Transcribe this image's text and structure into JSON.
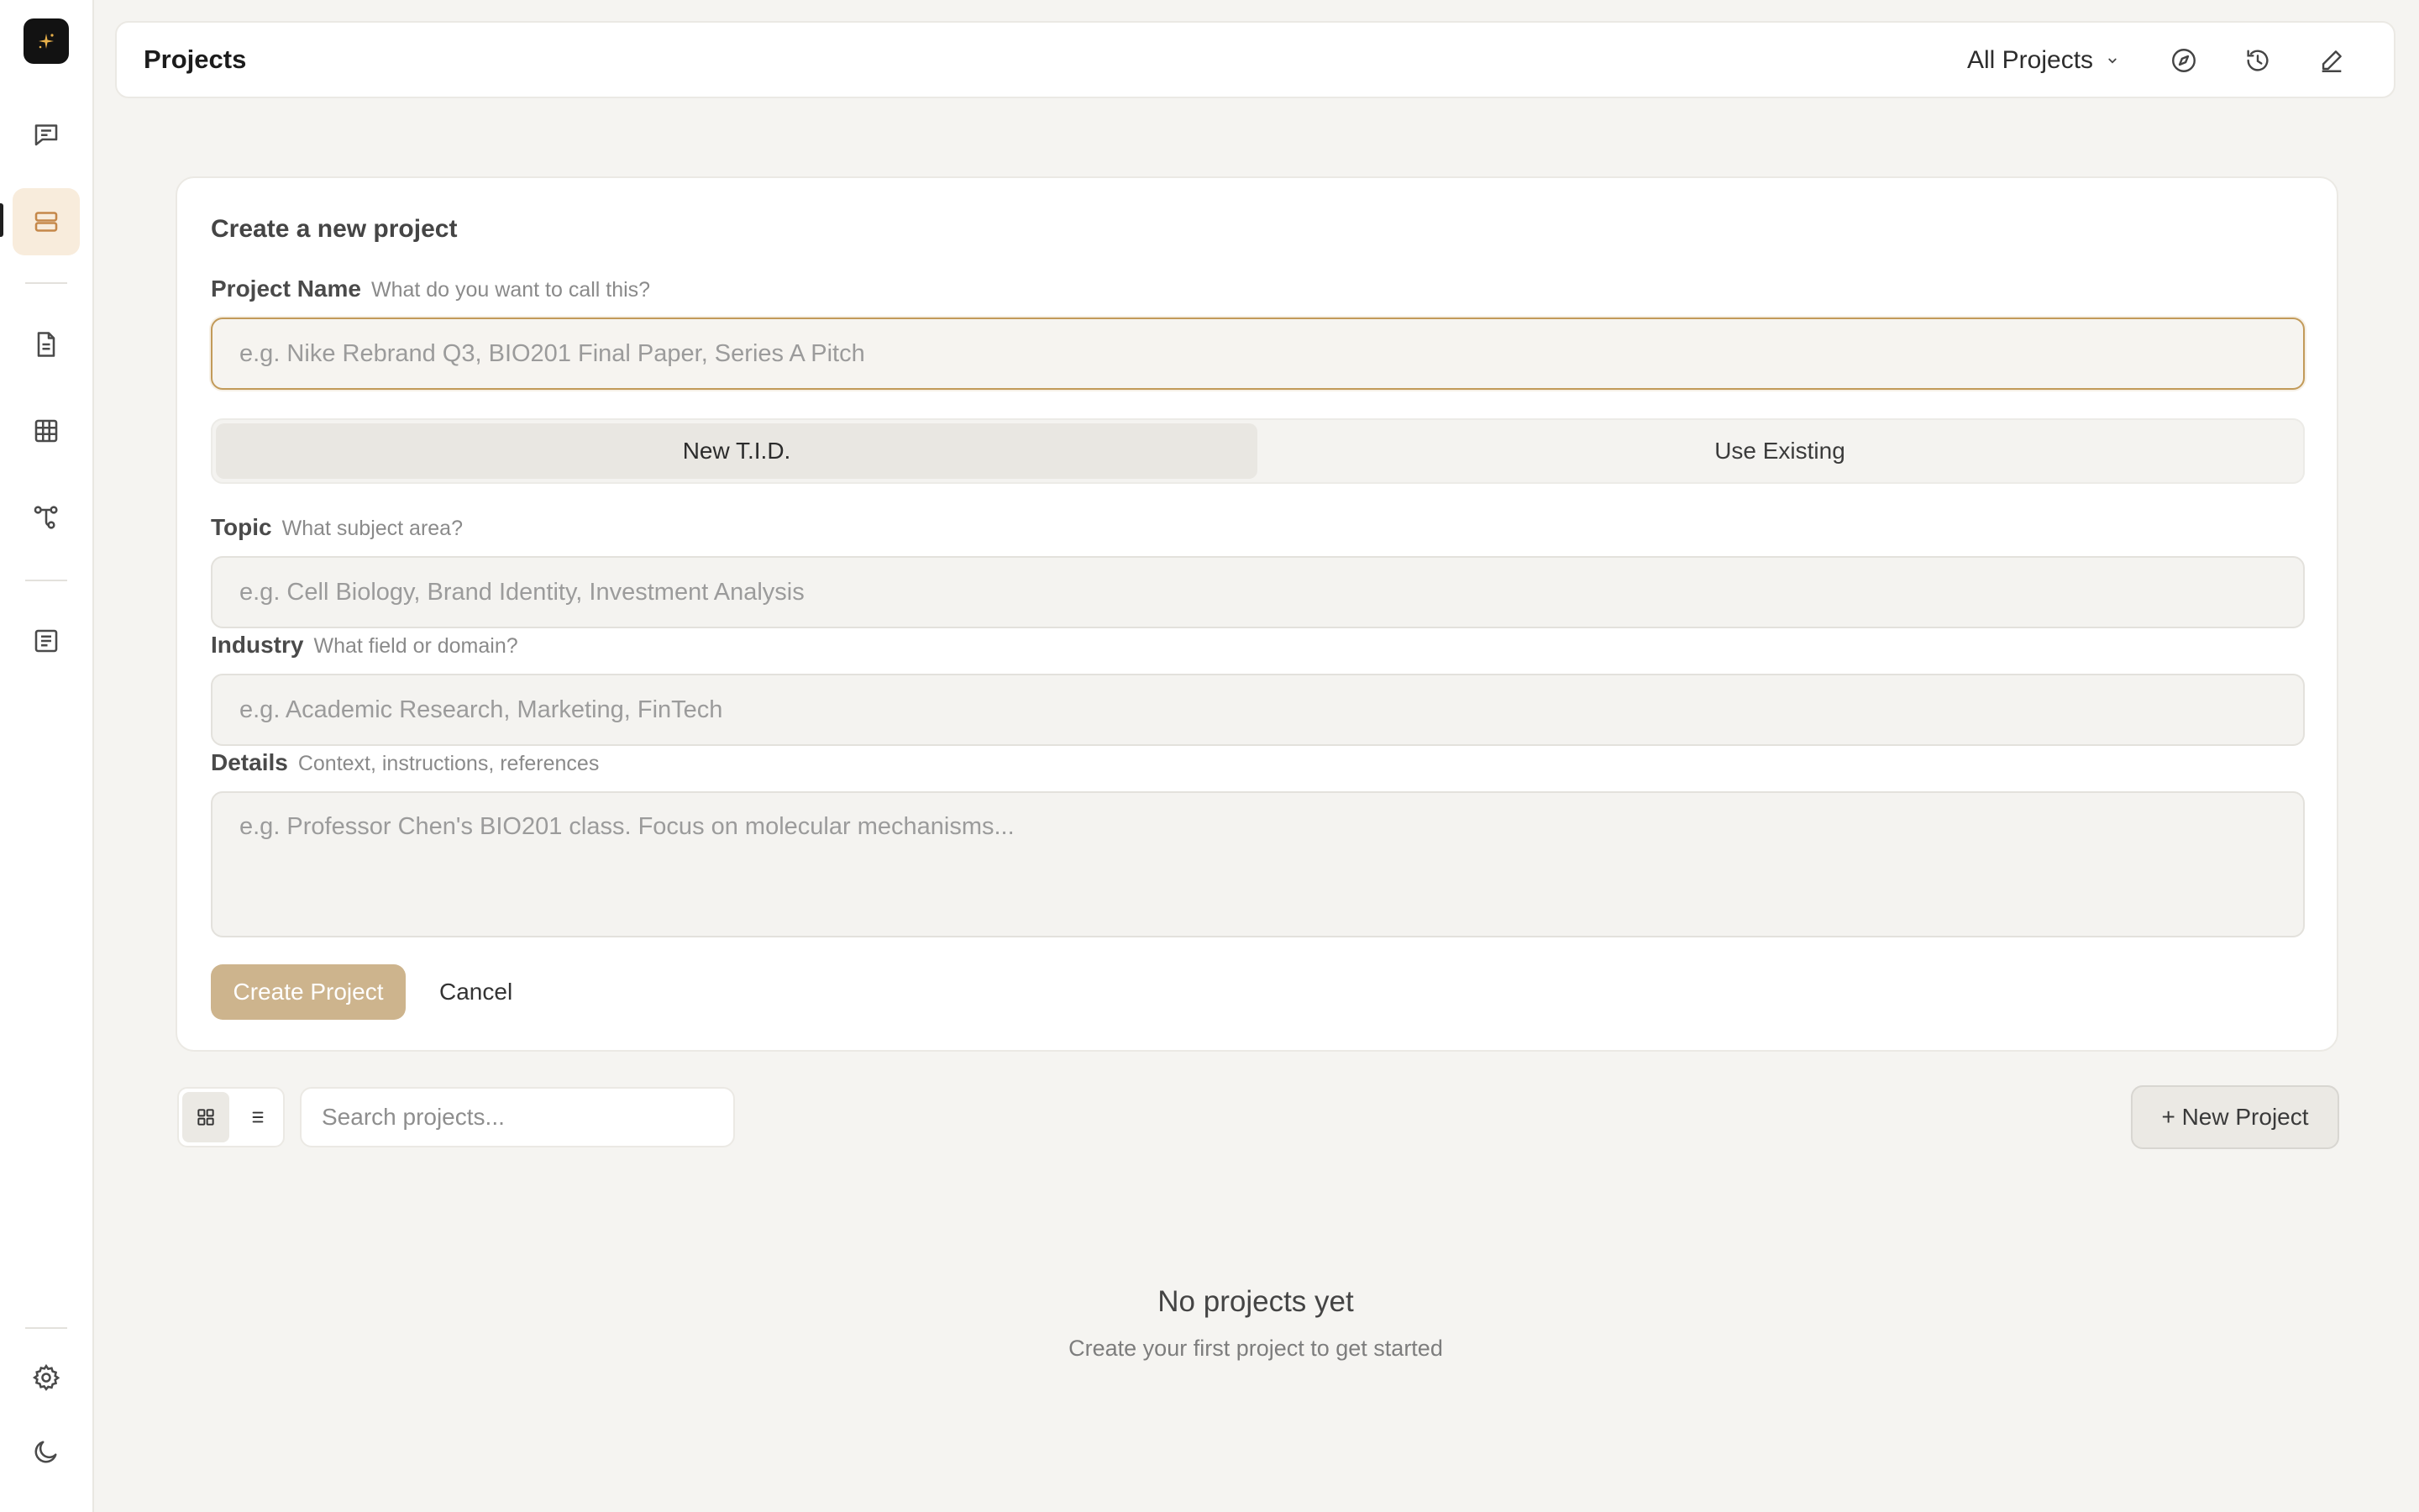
{
  "app": {
    "page_title": "Projects",
    "filter_label": "All Projects"
  },
  "sidebar": {
    "items": [
      {
        "icon": "chat-icon"
      },
      {
        "icon": "projects-icon",
        "active": true
      },
      {
        "icon": "document-icon"
      },
      {
        "icon": "table-icon"
      },
      {
        "icon": "workflow-icon"
      },
      {
        "icon": "notes-icon"
      },
      {
        "icon": "gear-icon"
      },
      {
        "icon": "moon-icon"
      }
    ]
  },
  "form": {
    "title": "Create a new project",
    "project_name": {
      "label": "Project Name",
      "hint": "What do you want to call this?",
      "placeholder": "e.g. Nike Rebrand Q3, BIO201 Final Paper, Series A Pitch",
      "value": ""
    },
    "mode_tabs": [
      {
        "label": "New T.I.D.",
        "selected": true
      },
      {
        "label": "Use Existing",
        "selected": false
      }
    ],
    "topic": {
      "label": "Topic",
      "hint": "What subject area?",
      "placeholder": "e.g. Cell Biology, Brand Identity, Investment Analysis",
      "value": ""
    },
    "industry": {
      "label": "Industry",
      "hint": "What field or domain?",
      "placeholder": "e.g. Academic Research, Marketing, FinTech",
      "value": ""
    },
    "details": {
      "label": "Details",
      "hint": "Context, instructions, references",
      "placeholder": "e.g. Professor Chen's BIO201 class. Focus on molecular mechanisms...",
      "value": ""
    },
    "create_label": "Create Project",
    "cancel_label": "Cancel"
  },
  "toolbar": {
    "search_placeholder": "Search projects...",
    "new_project_label": "+ New Project",
    "view_mode": "grid"
  },
  "empty_state": {
    "title": "No projects yet",
    "subtitle": "Create your first project to get started"
  },
  "colors": {
    "accent": "#c29a59",
    "accent_soft": "#f8ecdc",
    "create_button": "#cdb48d",
    "background": "#f5f4f1"
  }
}
